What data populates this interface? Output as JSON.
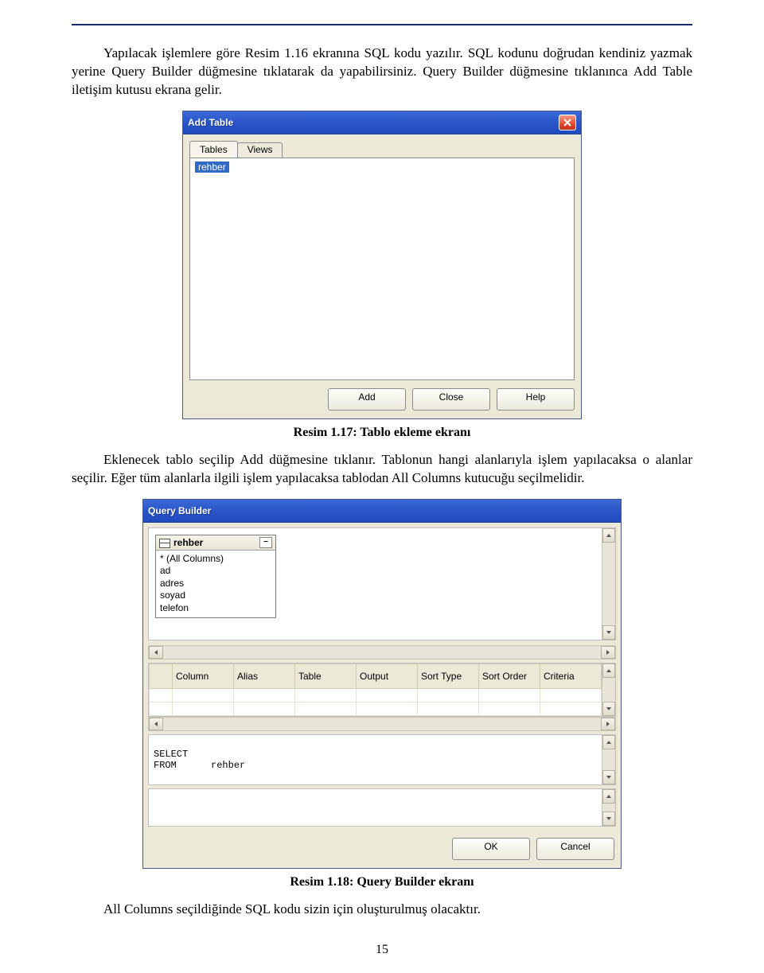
{
  "para1": "Yapılacak işlemlere göre Resim 1.16 ekranına SQL kodu yazılır. SQL kodunu doğrudan kendiniz yazmak yerine Query Builder düğmesine tıklatarak da yapabilirsiniz. Query Builder düğmesine tıklanınca Add Table iletişim kutusu ekrana gelir.",
  "addTable": {
    "title": "Add Table",
    "tabs": {
      "tables": "Tables",
      "views": "Views"
    },
    "item": "rehber",
    "buttons": {
      "add": "Add",
      "close": "Close",
      "help": "Help"
    }
  },
  "caption1": "Resim 1.17: Tablo ekleme ekranı",
  "para2": "Eklenecek tablo seçilip Add düğmesine tıklanır. Tablonun hangi alanlarıyla işlem yapılacaksa o alanlar seçilir. Eğer tüm alanlarla ilgili işlem yapılacaksa tablodan All Columns kutucuğu seçilmelidir.",
  "qb": {
    "title": "Query Builder",
    "table": {
      "name": "rehber",
      "cols": {
        "all": "* (All Columns)",
        "c1": "ad",
        "c2": "adres",
        "c3": "soyad",
        "c4": "telefon"
      }
    },
    "headers": {
      "column": "Column",
      "alias": "Alias",
      "table": "Table",
      "output": "Output",
      "sorttype": "Sort Type",
      "sortorder": "Sort Order",
      "criteria": "Criteria"
    },
    "sql": {
      "select": "SELECT",
      "from": "FROM",
      "tbl": "rehber"
    },
    "buttons": {
      "ok": "OK",
      "cancel": "Cancel"
    }
  },
  "caption2": "Resim 1.18: Query Builder ekranı",
  "para3": "All Columns seçildiğinde SQL kodu sizin için oluşturulmuş olacaktır.",
  "pagenum": "15"
}
